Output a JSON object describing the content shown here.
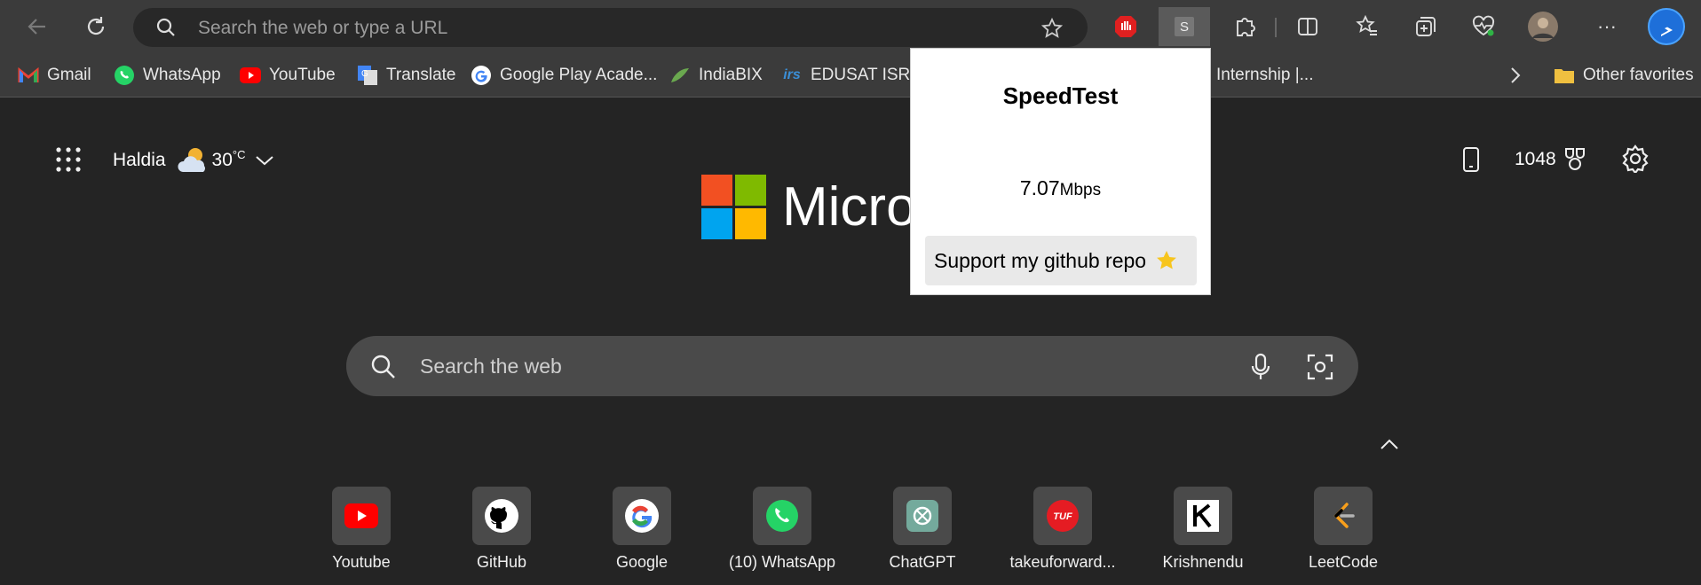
{
  "address_bar": {
    "placeholder": "Search the web or type a URL"
  },
  "toolbar": {
    "extension_s_label": "S",
    "more_label": "···"
  },
  "bookmarks": [
    {
      "label": "Gmail",
      "icon": "gmail-icon"
    },
    {
      "label": "WhatsApp",
      "icon": "whatsapp-icon"
    },
    {
      "label": "YouTube",
      "icon": "youtube-icon"
    },
    {
      "label": "Translate",
      "icon": "translate-icon"
    },
    {
      "label": "Google Play Acade...",
      "icon": "google-icon"
    },
    {
      "label": "IndiaBIX",
      "icon": "indiabix-icon"
    },
    {
      "label": "EDUSAT ISRO",
      "icon": "irs-icon"
    },
    {
      "label": "Internship |...",
      "icon": "page-icon"
    }
  ],
  "other_favorites": "Other favorites",
  "weather": {
    "city": "Haldia",
    "temp": "30",
    "unit": "°C"
  },
  "rewards": {
    "points": "1048"
  },
  "brand": {
    "text": "Micro"
  },
  "search": {
    "placeholder": "Search the web"
  },
  "tiles": [
    {
      "label": "Youtube",
      "icon": "youtube-icon"
    },
    {
      "label": "GitHub",
      "icon": "github-icon"
    },
    {
      "label": "Google",
      "icon": "google-icon"
    },
    {
      "label": "(10) WhatsApp",
      "icon": "whatsapp-icon"
    },
    {
      "label": "ChatGPT",
      "icon": "chatgpt-icon"
    },
    {
      "label": "takeuforward...",
      "icon": "tuf-icon"
    },
    {
      "label": "Krishnendu",
      "icon": "k-icon"
    },
    {
      "label": "LeetCode",
      "icon": "leetcode-icon"
    }
  ],
  "popup": {
    "title": "SpeedTest",
    "speed_value": "7.07",
    "speed_unit": "Mbps",
    "button_label": "Support my github repo"
  },
  "colors": {
    "ms_red": "#f25022",
    "ms_green": "#7fba00",
    "ms_blue": "#00a4ef",
    "ms_yellow": "#ffb900"
  }
}
